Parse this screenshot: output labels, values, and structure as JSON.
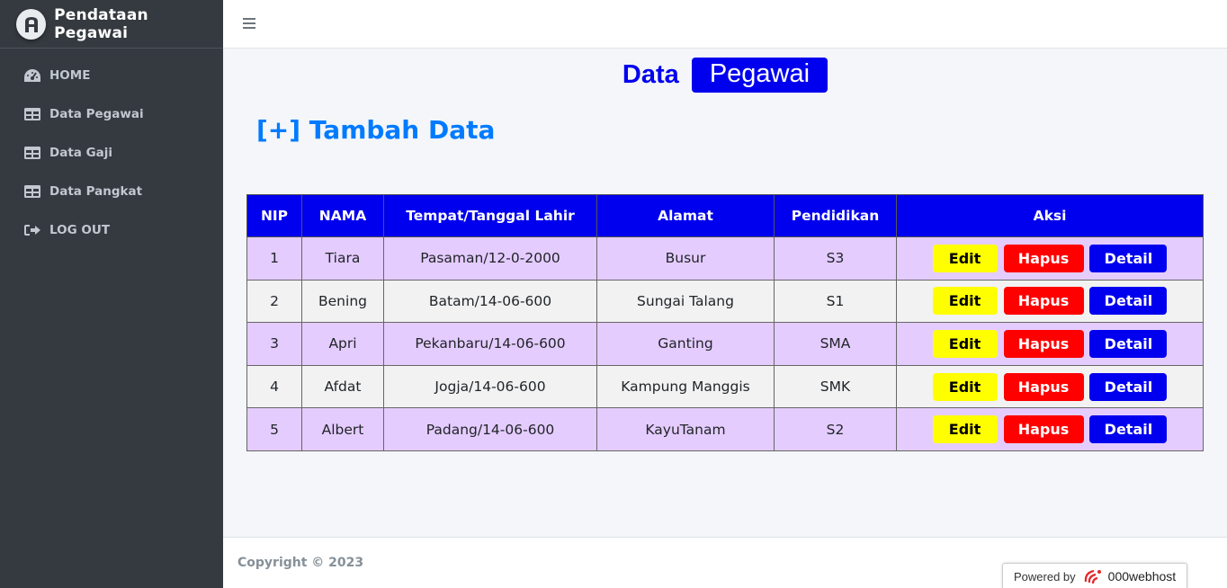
{
  "brand": {
    "title": "Pendataan Pegawai"
  },
  "sidebar": {
    "items": [
      {
        "label": "HOME",
        "icon": "dashboard-icon"
      },
      {
        "label": "Data Pegawai",
        "icon": "table-icon"
      },
      {
        "label": "Data Gaji",
        "icon": "table-icon"
      },
      {
        "label": "Data Pangkat",
        "icon": "table-icon"
      },
      {
        "label": "LOG OUT",
        "icon": "sign-out-icon"
      }
    ]
  },
  "header": {
    "title_part1": "Data",
    "title_part2": "Pegawai"
  },
  "main": {
    "add_label": "[+] Tambah Data"
  },
  "table": {
    "columns": [
      "NIP",
      "NAMA",
      "Tempat/Tanggal Lahir",
      "Alamat",
      "Pendidikan",
      "Aksi"
    ],
    "rows": [
      {
        "nip": "1",
        "nama": "Tiara",
        "ttl": "Pasaman/12-0-2000",
        "alamat": "Busur",
        "pendidikan": "S3"
      },
      {
        "nip": "2",
        "nama": "Bening",
        "ttl": "Batam/14-06-600",
        "alamat": "Sungai Talang",
        "pendidikan": "S1"
      },
      {
        "nip": "3",
        "nama": "Apri",
        "ttl": "Pekanbaru/14-06-600",
        "alamat": "Ganting",
        "pendidikan": "SMA"
      },
      {
        "nip": "4",
        "nama": "Afdat",
        "ttl": "Jogja/14-06-600",
        "alamat": "Kampung Manggis",
        "pendidikan": "SMK"
      },
      {
        "nip": "5",
        "nama": "Albert",
        "ttl": "Padang/14-06-600",
        "alamat": "KayuTanam",
        "pendidikan": "S2"
      }
    ],
    "actions": {
      "edit": "Edit",
      "hapus": "Hapus",
      "detail": "Detail"
    }
  },
  "footer": {
    "copyright": "Copyright © 2023",
    "powered_by": "Powered by",
    "host_brand": "000webhost"
  },
  "colors": {
    "sidebar_bg": "#343a40",
    "header_blue": "#0000ee",
    "link_blue": "#007bff",
    "row_odd": "#e5ccff",
    "row_even": "#f2f2f2",
    "edit_yellow": "#ffff00",
    "hapus_red": "#ff0000"
  }
}
